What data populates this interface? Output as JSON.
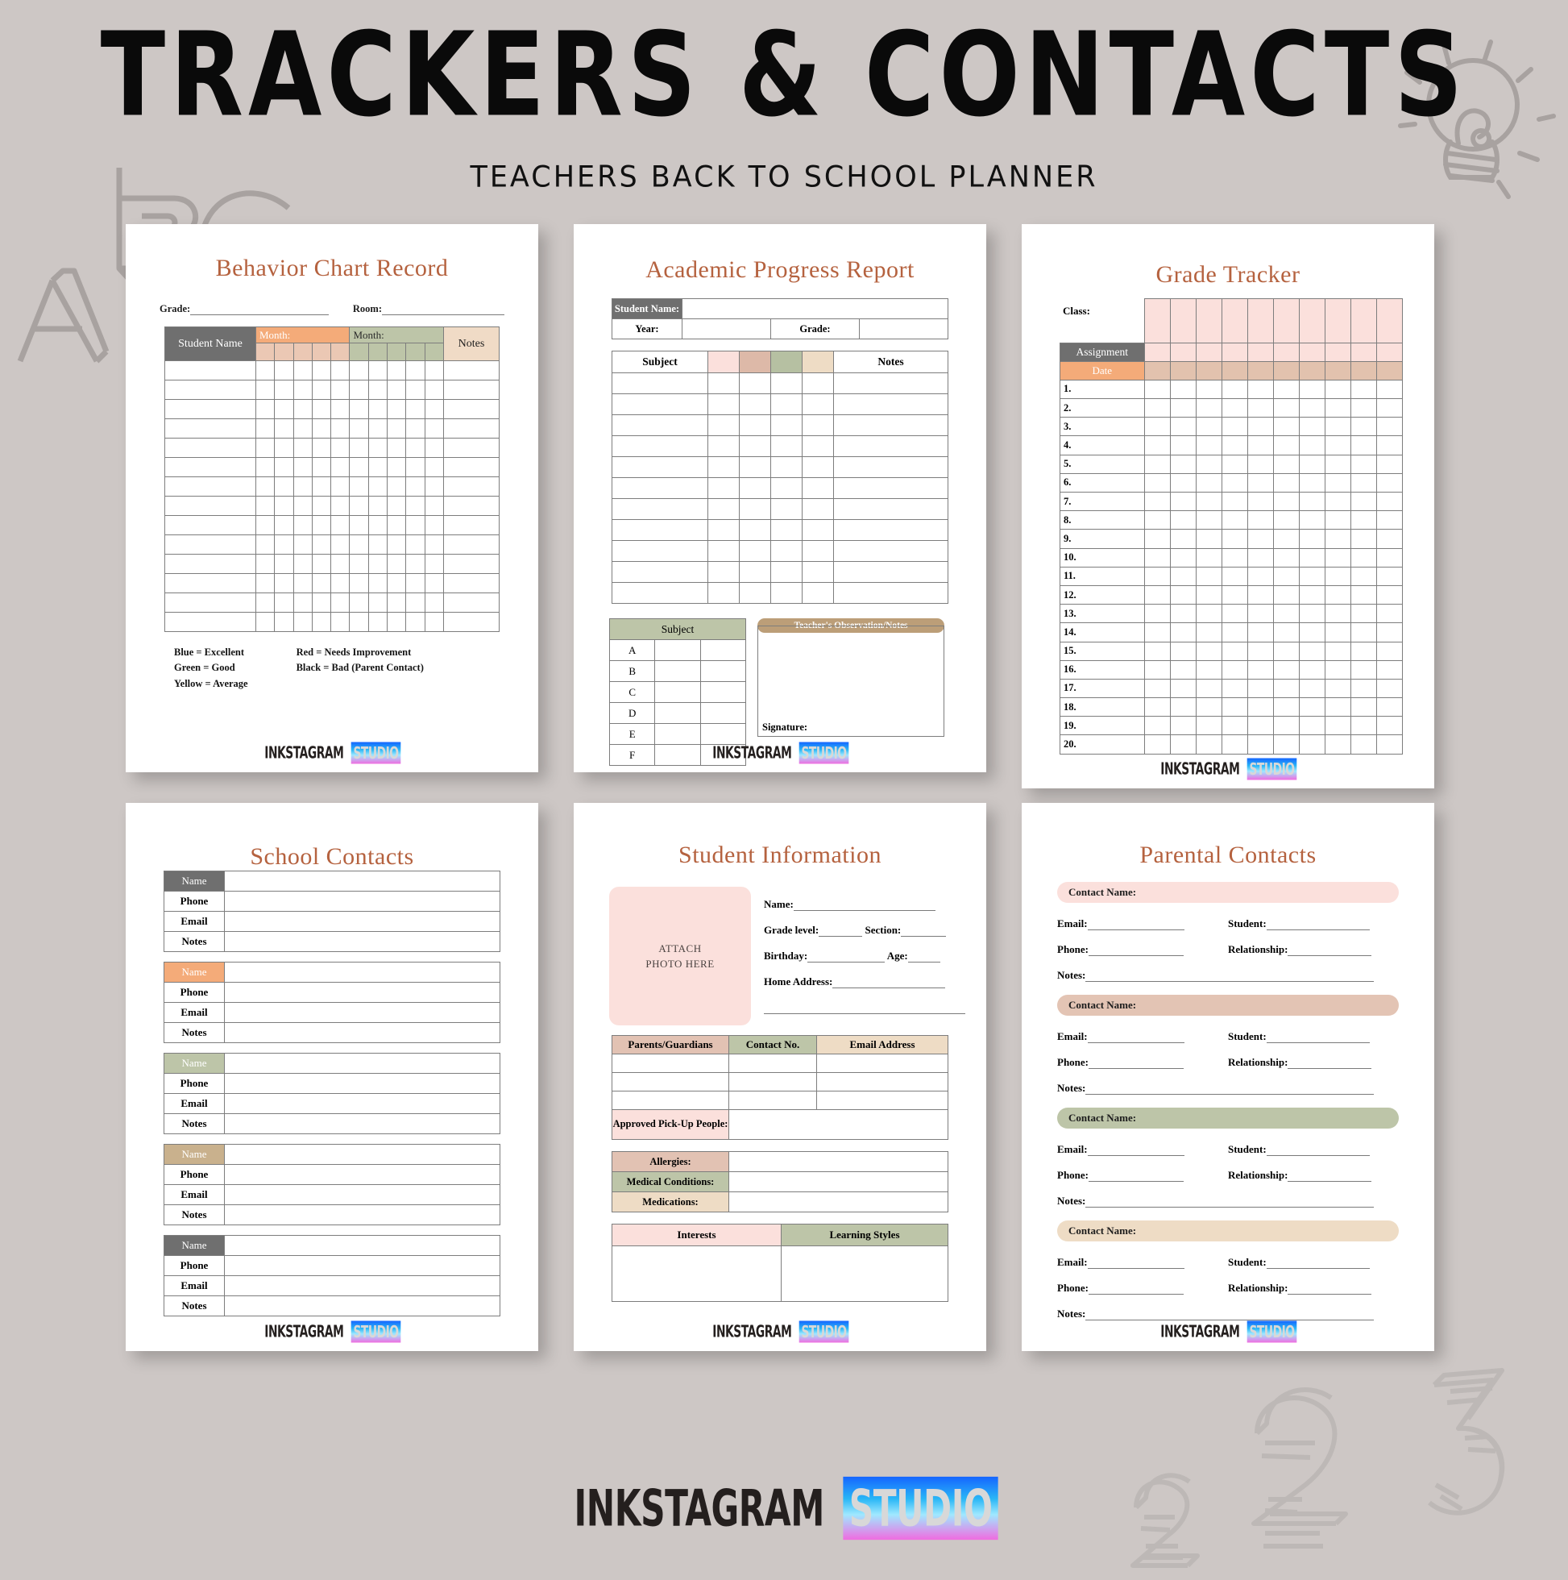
{
  "header": {
    "title": "TRACKERS & CONTACTS",
    "subtitle": "TEACHERS BACK TO SCHOOL PLANNER"
  },
  "brand": {
    "word1": "INKSTAGRAM",
    "word2": "STUDIO"
  },
  "colors": {
    "background": "#cdc7c5",
    "title_accent": "#b5623f",
    "gray_header": "#6f6f6f",
    "orange": "#f4ab79",
    "sage": "#bdc5a8",
    "tan": "#f0dbc6",
    "pink": "#fbe0dc",
    "rose": "#ddb9a8",
    "khaki": "#c9b18d"
  },
  "sheets": {
    "behavior": {
      "title": "Behavior Chart Record",
      "fields": {
        "grade": "Grade:",
        "room": "Room:"
      },
      "table": {
        "student_name": "Student Name",
        "month1": "Month:",
        "month2": "Month:",
        "notes": "Notes",
        "sub_cols_per_month": 5,
        "body_rows": 14
      },
      "legend": {
        "col1": [
          "Blue = Excellent",
          "Green = Good",
          "Yellow = Average"
        ],
        "col2": [
          "Red = Needs Improvement",
          "Black = Bad (Parent Contact)"
        ]
      }
    },
    "academic": {
      "title": "Academic Progress Report",
      "student_name": "Student Name:",
      "year": "Year:",
      "grade": "Grade:",
      "subject": "Subject",
      "notes": "Notes",
      "body_rows": 11,
      "subject_table": {
        "header": "Subject",
        "rows": [
          "A",
          "B",
          "C",
          "D",
          "E",
          "F"
        ]
      },
      "observation": {
        "header": "Teacher's Observation/Notes",
        "signature": "Signature:"
      }
    },
    "grade_tracker": {
      "title": "Grade Tracker",
      "class": "Class:",
      "assignment": "Assignment",
      "date": "Date",
      "columns": 10,
      "rows": [
        "1.",
        "2.",
        "3.",
        "4.",
        "5.",
        "6.",
        "7.",
        "8.",
        "9.",
        "10.",
        "11.",
        "12.",
        "13.",
        "14.",
        "15.",
        "16.",
        "17.",
        "18.",
        "19.",
        "20."
      ]
    },
    "school_contacts": {
      "title": "School Contacts",
      "labels": [
        "Name",
        "Phone",
        "Email",
        "Notes"
      ],
      "blocks": [
        {
          "name_color": "#6f6f6f"
        },
        {
          "name_color": "#f4ab79"
        },
        {
          "name_color": "#bdc5a8"
        },
        {
          "name_color": "#c9b18d"
        },
        {
          "name_color": "#6f6f6f"
        }
      ]
    },
    "student_info": {
      "title": "Student Information",
      "photo_line1": "ATTACH",
      "photo_line2": "PHOTO HERE",
      "name": "Name:",
      "grade_level": "Grade level:",
      "section": "Section:",
      "birthday": "Birthday:",
      "age": "Age:",
      "home_address": "Home Address:",
      "parents_table": {
        "headers": [
          "Parents/Guardians",
          "Contact No.",
          "Email Address"
        ],
        "rows": 3,
        "pickup_label": "Approved Pick-Up People:"
      },
      "medical": [
        {
          "label": "Allergies:",
          "color": "#e2c2b3"
        },
        {
          "label": "Medical Conditions:",
          "color": "#bdc5a8"
        },
        {
          "label": "Medications:",
          "color": "#eedcc5"
        }
      ],
      "interests_table": {
        "interests": "Interests",
        "learning_styles": "Learning Styles"
      }
    },
    "parental_contacts": {
      "title": "Parental Contacts",
      "contact_name": "Contact Name:",
      "email": "Email:",
      "student": "Student:",
      "phone": "Phone:",
      "relationship": "Relationship:",
      "notes": "Notes:",
      "bar_colors": [
        "#fbe0dc",
        "#e3c4b4",
        "#bdc5a8",
        "#eedcc5"
      ]
    }
  }
}
